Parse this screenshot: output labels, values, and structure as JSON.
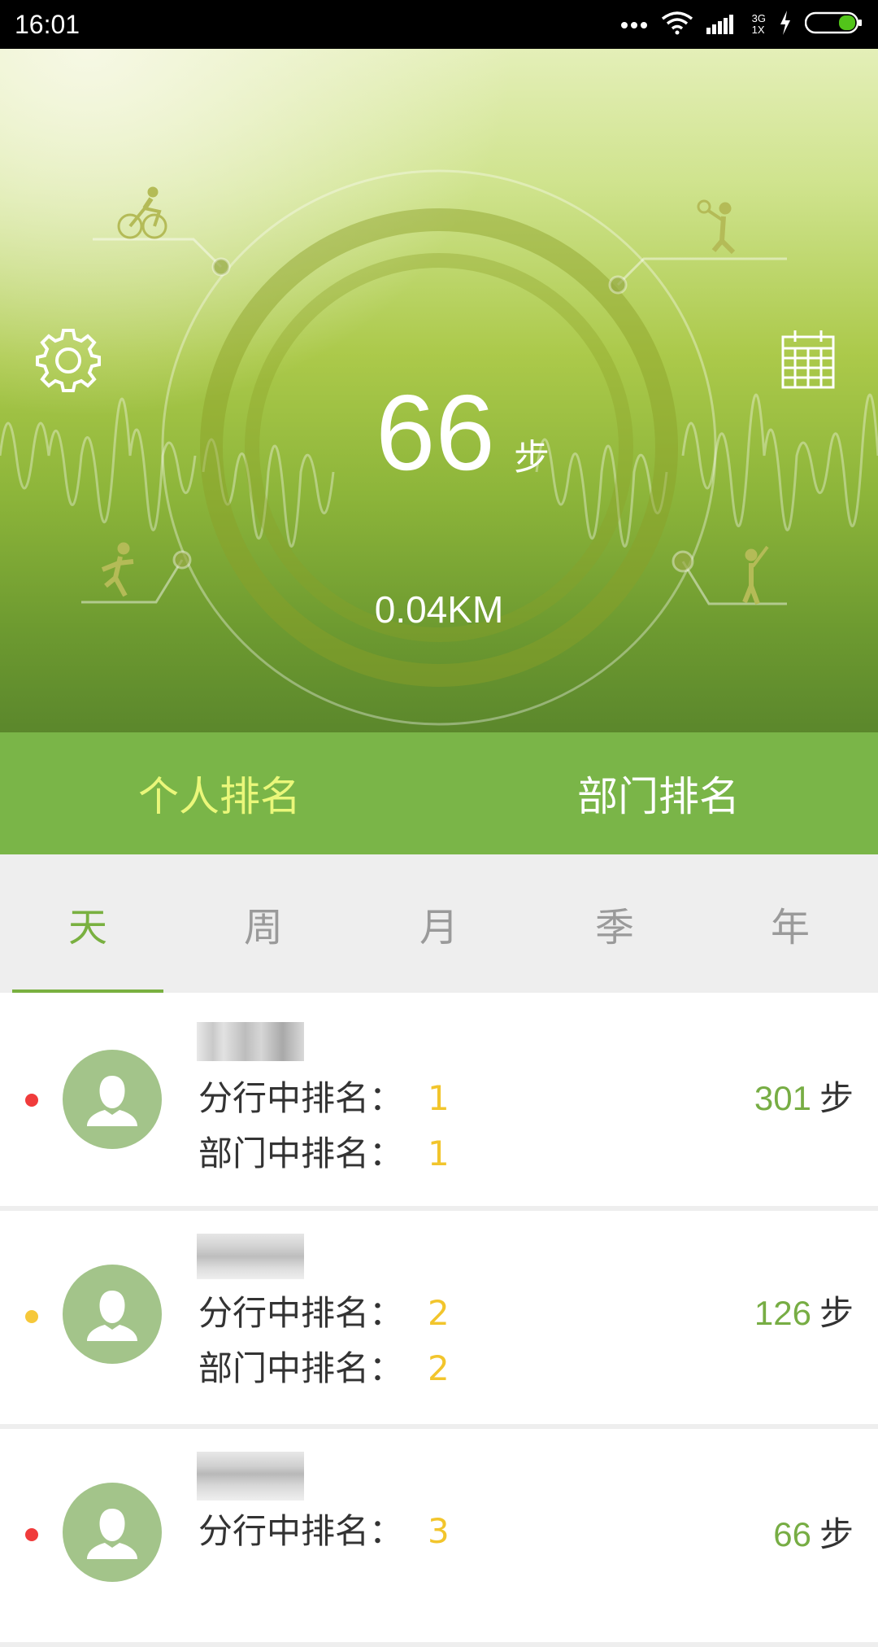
{
  "status_bar": {
    "time": "16:01",
    "network_label_top": "3G",
    "network_label_bottom": "1X"
  },
  "hero": {
    "steps_value": "66",
    "steps_unit": "步",
    "distance": "0.04KM",
    "icons": [
      "gear-icon",
      "calendar-icon",
      "cyclist-icon",
      "tennis-player-icon",
      "runner-icon",
      "baseball-player-icon"
    ]
  },
  "rank_tabs": [
    {
      "label": "个人排名",
      "active": true
    },
    {
      "label": "部门排名",
      "active": false
    }
  ],
  "period_tabs": [
    {
      "label": "天",
      "active": true
    },
    {
      "label": "周",
      "active": false
    },
    {
      "label": "月",
      "active": false
    },
    {
      "label": "季",
      "active": false
    },
    {
      "label": "年",
      "active": false
    }
  ],
  "list": [
    {
      "dot_color": "#f03b3b",
      "branch_label": "分行中排名：",
      "branch_rank": "1",
      "dept_label": "部门中排名：",
      "dept_rank": "1",
      "steps": "301",
      "unit": "步"
    },
    {
      "dot_color": "#f6c83a",
      "branch_label": "分行中排名：",
      "branch_rank": "2",
      "dept_label": "部门中排名：",
      "dept_rank": "2",
      "steps": "126",
      "unit": "步"
    },
    {
      "dot_color": "#f03b3b",
      "branch_label": "分行中排名：",
      "branch_rank": "3",
      "steps": "66",
      "unit": "步"
    }
  ],
  "colors": {
    "accent_green": "#7ab548",
    "rank_yellow": "#f2c52c",
    "active_tab_text": "#eaf77a"
  }
}
